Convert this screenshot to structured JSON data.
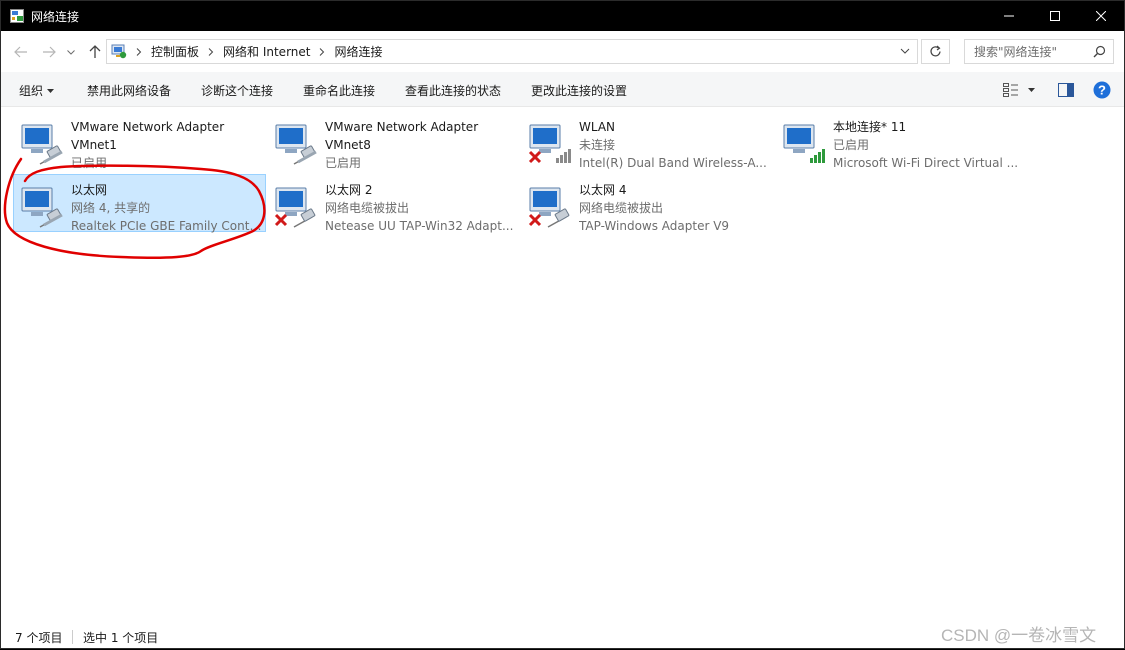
{
  "window": {
    "title": "网络连接"
  },
  "address": {
    "crumbs": [
      "控制面板",
      "网络和 Internet",
      "网络连接"
    ],
    "search_placeholder": "搜索\"网络连接\""
  },
  "commands": {
    "organize": "组织",
    "disable": "禁用此网络设备",
    "diagnose": "诊断这个连接",
    "rename": "重命名此连接",
    "status": "查看此连接的状态",
    "settings": "更改此连接的设置"
  },
  "connections": [
    {
      "name": "VMware Network Adapter",
      "name2": "VMnet1",
      "status": "已启用",
      "device": "",
      "state": "enabled"
    },
    {
      "name": "VMware Network Adapter",
      "name2": "VMnet8",
      "status": "已启用",
      "device": "",
      "state": "enabled"
    },
    {
      "name": "WLAN",
      "name2": "",
      "status": "未连接",
      "device": "Intel(R) Dual Band Wireless-A...",
      "state": "wifi-disconnected"
    },
    {
      "name": "本地连接* 11",
      "name2": "",
      "status": "已启用",
      "device": "Microsoft Wi-Fi Direct Virtual ...",
      "state": "wifi-enabled"
    },
    {
      "name": "以太网",
      "name2": "",
      "status": "网络 4, 共享的",
      "device": "Realtek PCIe GBE Family Contr...",
      "state": "selected"
    },
    {
      "name": "以太网 2",
      "name2": "",
      "status": "网络电缆被拔出",
      "device": "Netease UU TAP-Win32 Adapt...",
      "state": "unplugged"
    },
    {
      "name": "以太网 4",
      "name2": "",
      "status": "网络电缆被拔出",
      "device": "TAP-Windows Adapter V9",
      "state": "unplugged"
    }
  ],
  "statusbar": {
    "count": "7 个项目",
    "selected": "选中 1 个项目"
  },
  "watermark": "CSDN @一卷冰雪文",
  "colors": {
    "selection_bg": "#cce8ff",
    "selection_border": "#99d1ff",
    "annotation": "#e00000",
    "help_blue": "#1e6fd9"
  }
}
